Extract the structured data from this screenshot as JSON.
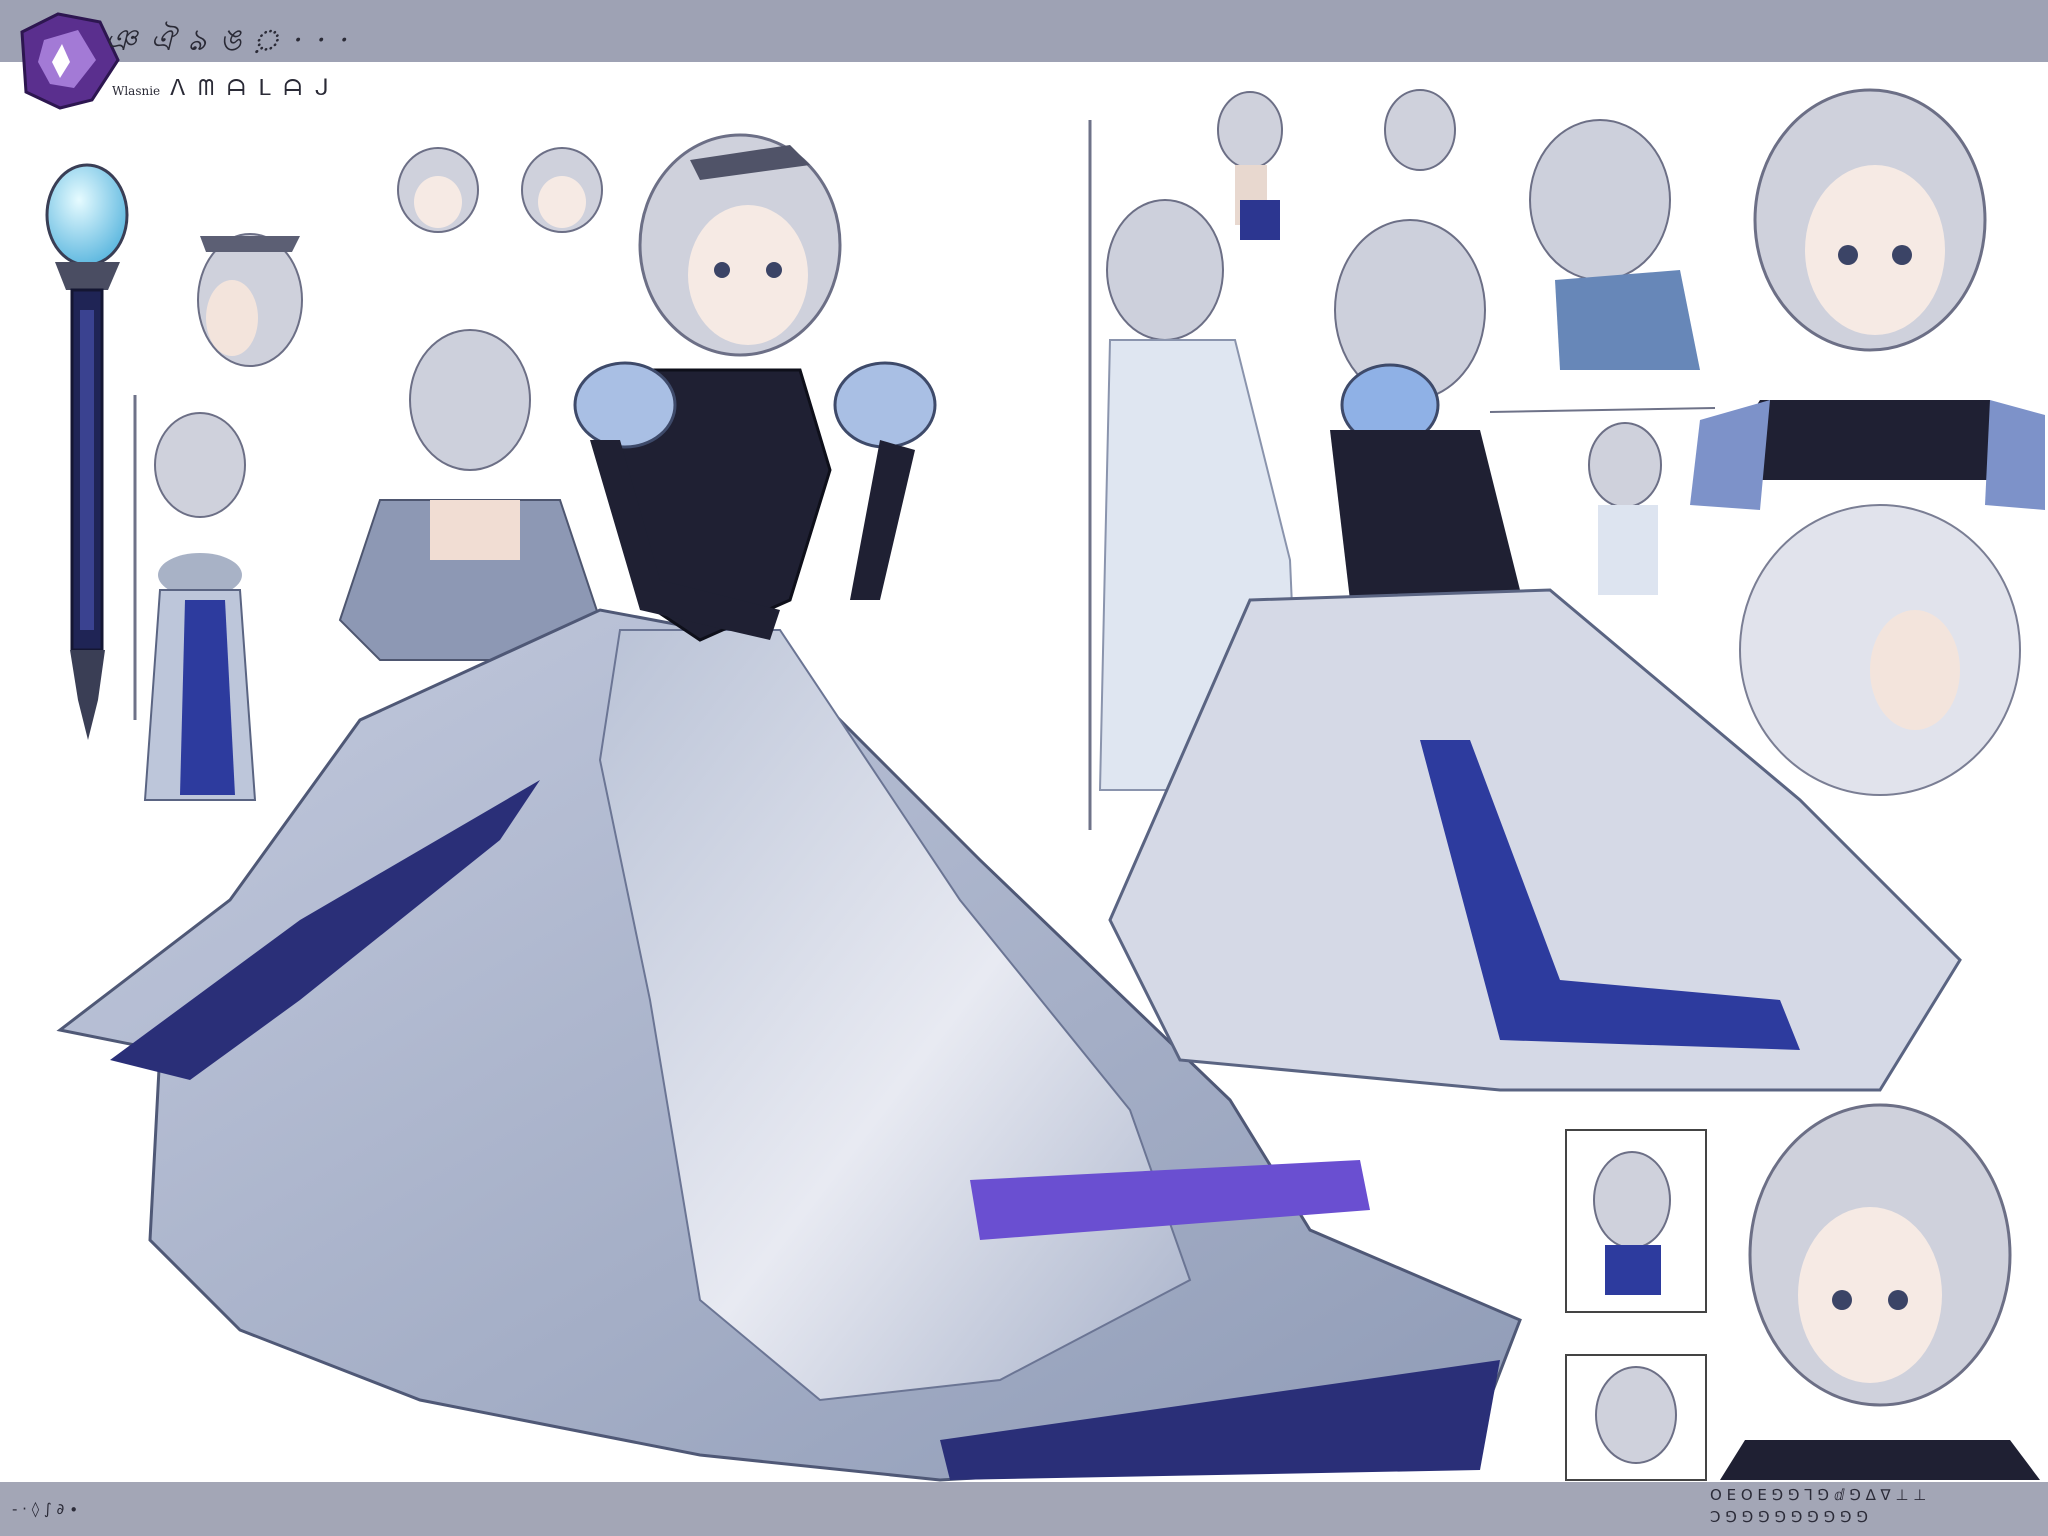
{
  "sheet": {
    "title": "ঞ ঐ ঌ ঙ ়  · · ·",
    "subtitle_small": "Wlasnie",
    "subtitle": "ᐱ ᗰ ᗩ ᒪ ᗩ ᒍ",
    "footer_left": "- · ◊ ∫ ∂ ∙",
    "footer_right_line1": "Ο Ε Ο Ε ⅁ ⅁ ⅂ ⅁ ⅆ ⅁ ∆ ∇ ⊥ ⊥",
    "footer_right_line2": "Ↄ ⅁   ⅁ ⅁ ⅁ ⅁ ⅁ ⅁ ⅁ ⅁"
  },
  "palette": {
    "hair": "#cfd0dc",
    "dress_light": "#e9ebf2",
    "dress_shadow": "#aab2c8",
    "navy": "#2a2f78",
    "violet": "#6a4fd1",
    "bodice": "#1f2033",
    "gem": "#8fd6f0",
    "emblem": "#6b3fa0"
  }
}
